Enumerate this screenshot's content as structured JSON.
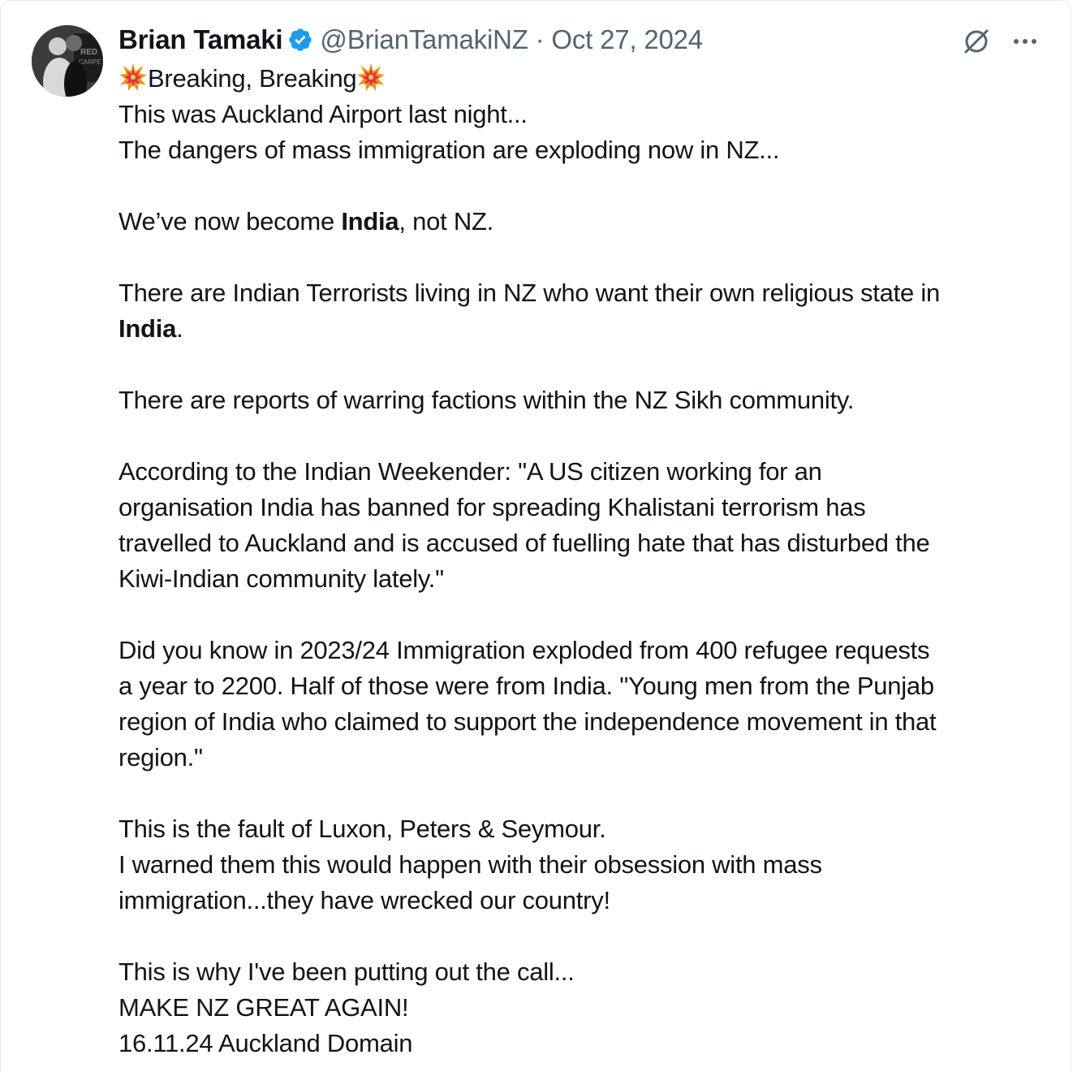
{
  "tweet": {
    "author_name": "Brian Tamaki",
    "handle_and_date": "@BrianTamakiNZ · Oct 27, 2024",
    "colors": {
      "text": "#0f1419",
      "meta": "#536471",
      "verified": "#1d9bf0",
      "emoji": "#e0324b"
    },
    "icons": {
      "avatar": "profile-photo",
      "verified": "verified-badge-icon",
      "grok": "grok-icon",
      "more": "more-dots-icon",
      "collision": "collision-emoji-icon"
    },
    "headline": "Breaking, Breaking",
    "line_1": "This was Auckland Airport last night...",
    "line_2": "The dangers of mass immigration are exploding now in NZ...",
    "para_india_prefix": "We’ve now become ",
    "para_india_bold": "India",
    "para_india_suffix": ", not NZ.",
    "para_terror_prefix": "There are Indian Terrorists living in NZ who want their own religious state in",
    "para_terror_bold": "India",
    "para_terror_suffix": ".",
    "para_factions": "There are reports of warring factions within the NZ Sikh community.",
    "para_weekender_1": "According to the Indian Weekender: \"A US citizen working for an",
    "para_weekender_2": "organisation India has banned for spreading Khalistani terrorism has",
    "para_weekender_3": "travelled to Auckland and is accused of fuelling hate that has disturbed the",
    "para_weekender_4": "Kiwi-Indian community lately.\"",
    "para_refugee_1": "Did you know in 2023/24 Immigration exploded from 400 refugee requests",
    "para_refugee_2": "a year to 2200. Half of those were from India. \"Young men from the Punjab",
    "para_refugee_3": "region of India who claimed to support the independence movement in that",
    "para_refugee_4": "region.\"",
    "para_fault_1": "This is the fault of Luxon, Peters & Seymour.",
    "para_fault_2": "I warned them this would happen with their obsession with mass",
    "para_fault_3": "immigration...they have wrecked our country!",
    "para_call_1": "This is why I've been putting out the call...",
    "para_call_2": "MAKE NZ GREAT AGAIN!",
    "para_call_3": "16.11.24 Auckland Domain"
  }
}
